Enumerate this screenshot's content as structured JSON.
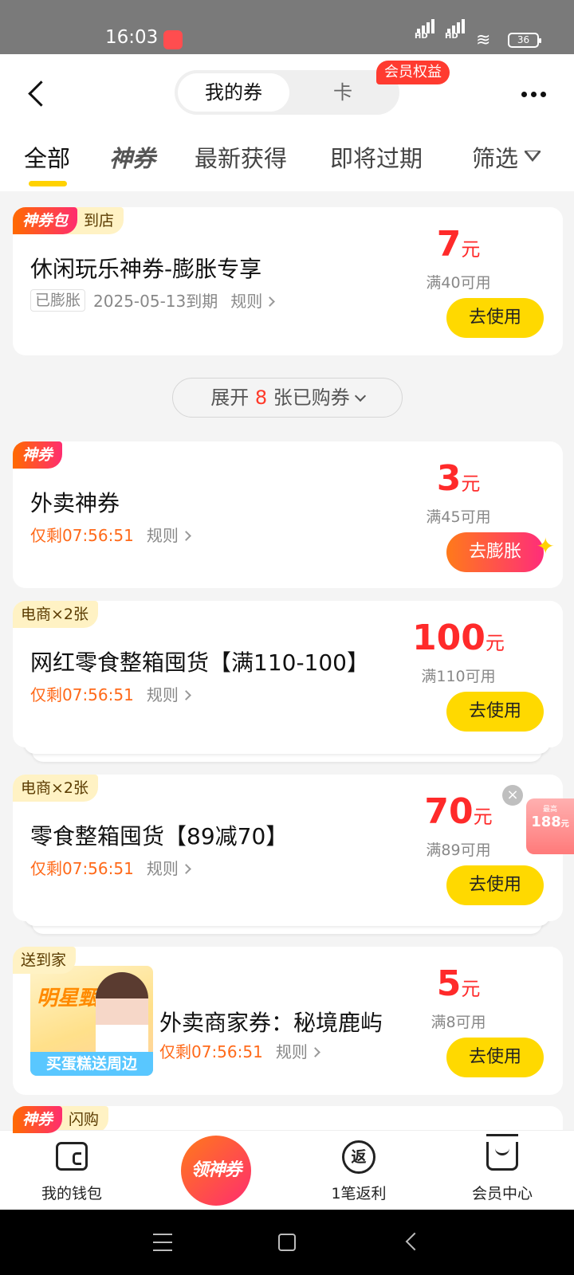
{
  "status_bar": {
    "time": "16:03",
    "signal1": "HD",
    "signal2": "HD",
    "battery": "36"
  },
  "header": {
    "segment_coupons": "我的券",
    "segment_cards": "卡",
    "member_badge": "会员权益",
    "tabs": [
      "全部",
      "神券",
      "最新获得",
      "即将过期",
      "筛选"
    ]
  },
  "coupons": [
    {
      "tag1": "神券包",
      "tag2": "到店",
      "title": "休闲玩乐神券-膨胀专享",
      "chip": "已膨胀",
      "expiry": "2025-05-13到期",
      "rule": "规则",
      "amount": "7",
      "unit": "元",
      "condition": "满40可用",
      "button": "去使用"
    },
    {
      "tag1": "神券",
      "title": "外卖神券",
      "countdown": "仅剩07:56:51",
      "rule": "规则",
      "amount": "3",
      "unit": "元",
      "condition": "满45可用",
      "button": "去膨胀"
    },
    {
      "tag1": "电商×2张",
      "title": "网红零食整箱囤货【满110-100】",
      "countdown": "仅剩07:56:51",
      "rule": "规则",
      "amount": "100",
      "unit": "元",
      "condition": "满110可用",
      "button": "去使用"
    },
    {
      "tag1": "电商×2张",
      "title": "零食整箱囤货【89减70】",
      "countdown": "仅剩07:56:51",
      "rule": "规则",
      "amount": "70",
      "unit": "元",
      "condition": "满89可用",
      "button": "去使用"
    },
    {
      "tag1": "送到家",
      "thumb_text": "明星甄选",
      "thumb_banner": "买蛋糕送周边",
      "title": "外卖商家券：秘境鹿屿",
      "countdown": "仅剩07:56:51",
      "rule": "规则",
      "amount": "5",
      "unit": "元",
      "condition": "满8可用",
      "button": "去使用"
    },
    {
      "tag1": "神券",
      "tag2": "闪购"
    }
  ],
  "expand": {
    "prefix": "展开",
    "count": "8",
    "suffix": "张已购券"
  },
  "float_widget": {
    "small": "最高",
    "amount": "188",
    "unit": "元"
  },
  "bottom_nav": {
    "wallet": "我的钱包",
    "center": "领神券",
    "rebate_icon": "返",
    "rebate": "1笔返利",
    "member": "会员中心"
  }
}
